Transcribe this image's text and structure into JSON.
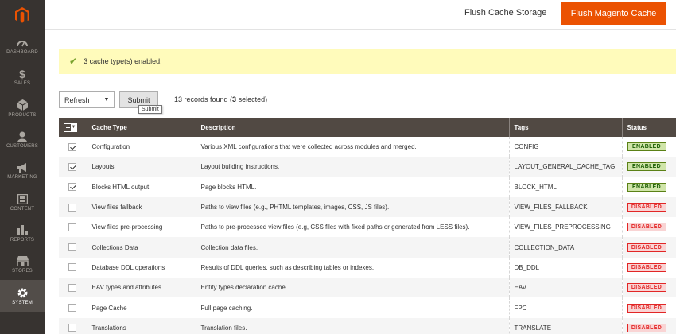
{
  "sidebar": {
    "items": [
      {
        "label": "DASHBOARD",
        "icon": "dashboard-icon"
      },
      {
        "label": "SALES",
        "icon": "dollar-icon"
      },
      {
        "label": "PRODUCTS",
        "icon": "cube-icon"
      },
      {
        "label": "CUSTOMERS",
        "icon": "person-icon"
      },
      {
        "label": "MARKETING",
        "icon": "megaphone-icon"
      },
      {
        "label": "CONTENT",
        "icon": "content-icon"
      },
      {
        "label": "REPORTS",
        "icon": "bar-chart-icon"
      },
      {
        "label": "STORES",
        "icon": "store-icon"
      },
      {
        "label": "SYSTEM",
        "icon": "gear-icon",
        "active": true
      }
    ]
  },
  "header": {
    "flush_storage_label": "Flush Cache Storage",
    "flush_magento_label": "Flush Magento Cache"
  },
  "message": {
    "text": "3 cache type(s) enabled."
  },
  "toolbar": {
    "action_value": "Refresh",
    "submit_label": "Submit",
    "tooltip": "Submit",
    "records_prefix": "13 records found (",
    "records_selected": "3",
    "records_suffix": " selected)"
  },
  "table": {
    "columns": [
      "Cache Type",
      "Description",
      "Tags",
      "Status"
    ],
    "rows": [
      {
        "checked": true,
        "type": "Configuration",
        "description": "Various XML configurations that were collected across modules and merged.",
        "tags": "CONFIG",
        "status": "ENABLED"
      },
      {
        "checked": true,
        "type": "Layouts",
        "description": "Layout building instructions.",
        "tags": "LAYOUT_GENERAL_CACHE_TAG",
        "status": "ENABLED"
      },
      {
        "checked": true,
        "type": "Blocks HTML output",
        "description": "Page blocks HTML.",
        "tags": "BLOCK_HTML",
        "status": "ENABLED"
      },
      {
        "checked": false,
        "type": "View files fallback",
        "description": "Paths to view files (e.g., PHTML templates, images, CSS, JS files).",
        "tags": "VIEW_FILES_FALLBACK",
        "status": "DISABLED"
      },
      {
        "checked": false,
        "type": "View files pre-processing",
        "description": "Paths to pre-processed view files (e.g, CSS files with fixed paths or generated from LESS files).",
        "tags": "VIEW_FILES_PREPROCESSING",
        "status": "DISABLED"
      },
      {
        "checked": false,
        "type": "Collections Data",
        "description": "Collection data files.",
        "tags": "COLLECTION_DATA",
        "status": "DISABLED"
      },
      {
        "checked": false,
        "type": "Database DDL operations",
        "description": "Results of DDL queries, such as describing tables or indexes.",
        "tags": "DB_DDL",
        "status": "DISABLED"
      },
      {
        "checked": false,
        "type": "EAV types and attributes",
        "description": "Entity types declaration cache.",
        "tags": "EAV",
        "status": "DISABLED"
      },
      {
        "checked": false,
        "type": "Page Cache",
        "description": "Full page caching.",
        "tags": "FPC",
        "status": "DISABLED"
      },
      {
        "checked": false,
        "type": "Translations",
        "description": "Translation files.",
        "tags": "TRANSLATE",
        "status": "DISABLED"
      }
    ]
  },
  "colors": {
    "sidebar_bg": "#373330",
    "accent": "#eb5202",
    "table_header_bg": "#514943",
    "notice_bg": "#fffbbb"
  }
}
